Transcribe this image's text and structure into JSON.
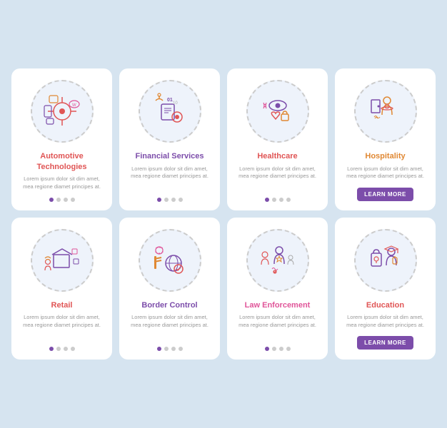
{
  "cards": [
    {
      "id": "automotive",
      "title": "Automotive Technologies",
      "title_color": "red",
      "body": "Lorem ipsum dolor sit dim amet, mea regione diamet principes at.",
      "has_learn_more": false,
      "dots": [
        true,
        false,
        false,
        false
      ],
      "icon_type": "automotive"
    },
    {
      "id": "financial",
      "title": "Financial Services",
      "title_color": "purple",
      "body": "Lorem ipsum dolor sit dim amet, mea regione diamet principes at.",
      "has_learn_more": false,
      "dots": [
        true,
        false,
        false,
        false
      ],
      "icon_type": "financial"
    },
    {
      "id": "healthcare",
      "title": "Healthcare",
      "title_color": "red",
      "body": "Lorem ipsum dolor sit dim amet, mea regione diamet principes at.",
      "has_learn_more": false,
      "dots": [
        true,
        false,
        false,
        false
      ],
      "icon_type": "healthcare"
    },
    {
      "id": "hospitality",
      "title": "Hospitality",
      "title_color": "orange",
      "body": "Lorem ipsum dolor sit dim amet, mea regione diamet principes at.",
      "has_learn_more": true,
      "dots": [],
      "icon_type": "hospitality"
    },
    {
      "id": "retail",
      "title": "Retail",
      "title_color": "red",
      "body": "Lorem ipsum dolor sit dim amet, mea regione diamet principes at.",
      "has_learn_more": false,
      "dots": [
        true,
        false,
        false,
        false
      ],
      "icon_type": "retail"
    },
    {
      "id": "border",
      "title": "Border Control",
      "title_color": "purple",
      "body": "Lorem ipsum dolor sit dim amet, mea regione diamet principes at.",
      "has_learn_more": false,
      "dots": [
        true,
        false,
        false,
        false
      ],
      "icon_type": "border"
    },
    {
      "id": "law",
      "title": "Law Enforcement",
      "title_color": "pink",
      "body": "Lorem ipsum dolor sit dim amet, mea regione diamet principes at.",
      "has_learn_more": false,
      "dots": [
        true,
        false,
        false,
        false
      ],
      "icon_type": "law"
    },
    {
      "id": "education",
      "title": "Education",
      "title_color": "red",
      "body": "Lorem ipsum dolor sit dim amet, mea regione diamet principes at.",
      "has_learn_more": true,
      "dots": [],
      "icon_type": "education"
    }
  ],
  "learn_more_label": "LEARN MORE"
}
